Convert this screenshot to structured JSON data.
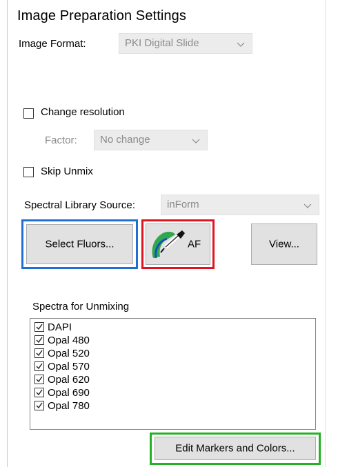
{
  "title": "Image Preparation Settings",
  "image_format": {
    "label": "Image Format:",
    "value": "PKI Digital Slide"
  },
  "change_resolution": {
    "label": "Change resolution",
    "checked": false
  },
  "factor": {
    "label": "Factor:",
    "value": "No change"
  },
  "skip_unmix": {
    "label": "Skip Unmix",
    "checked": false
  },
  "spectral_library": {
    "label": "Spectral Library Source:",
    "value": "inForm"
  },
  "buttons": {
    "select_fluors": "Select Fluors...",
    "af": "AF",
    "view": "View...",
    "edit_markers": "Edit Markers and Colors..."
  },
  "spectra": {
    "label": "Spectra for Unmixing",
    "items": [
      {
        "label": "DAPI",
        "checked": true
      },
      {
        "label": "Opal 480",
        "checked": true
      },
      {
        "label": "Opal 520",
        "checked": true
      },
      {
        "label": "Opal 570",
        "checked": true
      },
      {
        "label": "Opal 620",
        "checked": true
      },
      {
        "label": "Opal 690",
        "checked": true
      },
      {
        "label": "Opal 780",
        "checked": true
      }
    ]
  },
  "colors": {
    "highlight_blue": "#1f6fd6",
    "highlight_red": "#e0141e",
    "highlight_green": "#22b222",
    "icon_green": "#2fa84f",
    "icon_blue": "#1a4fb8"
  }
}
